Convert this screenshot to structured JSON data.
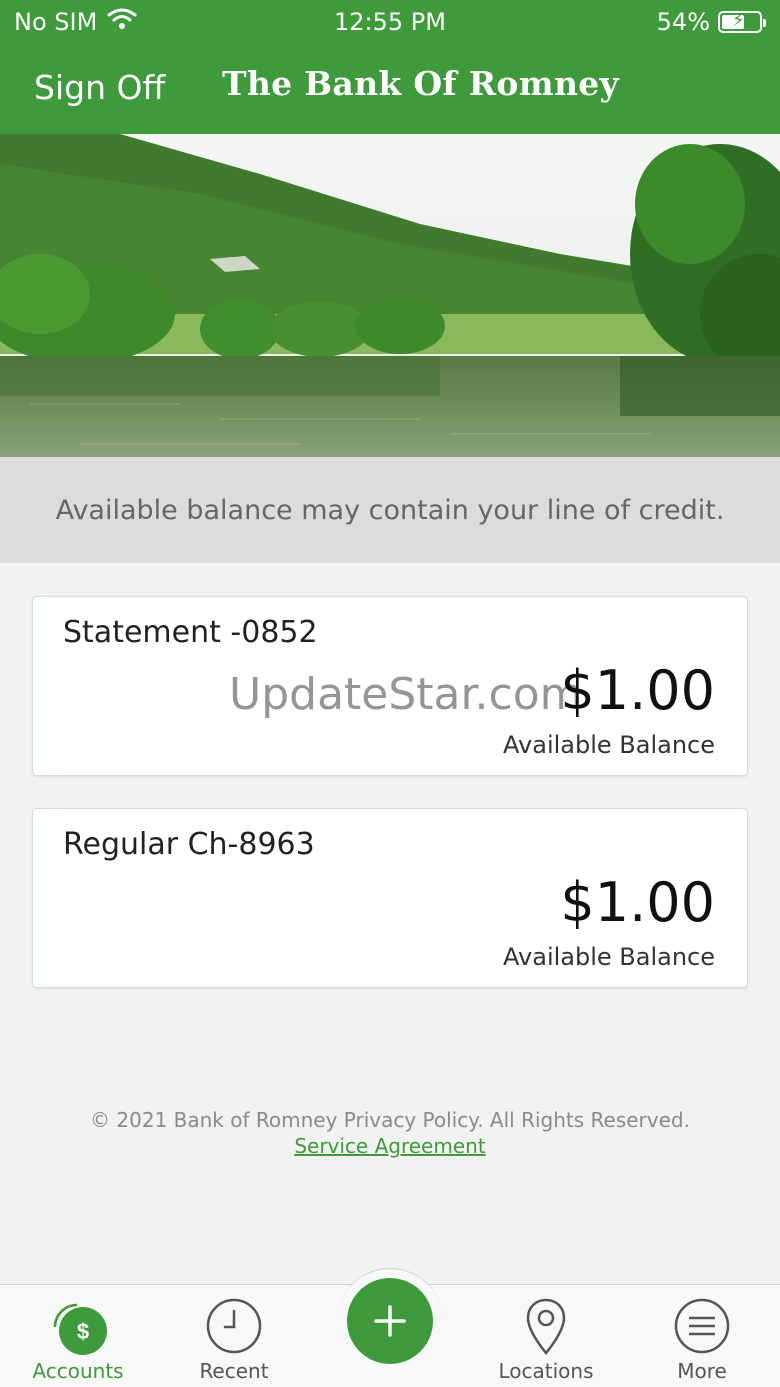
{
  "status_bar": {
    "carrier": "No SIM",
    "time": "12:55 PM",
    "battery": "54%",
    "battery_level": 0.54
  },
  "header": {
    "sign_off": "Sign Off",
    "brand": "The Bank Of Romney"
  },
  "notice": "Available balance may contain your line of credit.",
  "accounts": [
    {
      "name": "Statement -0852",
      "amount": "$1.00",
      "label": "Available Balance"
    },
    {
      "name": "Regular Ch-8963",
      "amount": "$1.00",
      "label": "Available Balance"
    }
  ],
  "watermark": "UpdateStar.com",
  "footer": {
    "copyright": "© 2021 Bank of Romney Privacy Policy. All Rights Reserved.",
    "service_agreement": "Service Agreement"
  },
  "tabs": [
    {
      "label": "Accounts",
      "icon": "dollar-icon",
      "active": true
    },
    {
      "label": "Recent",
      "icon": "clock-icon"
    },
    {
      "label": "add",
      "icon": "plus-icon"
    },
    {
      "label": "Locations",
      "icon": "location-pin-icon"
    },
    {
      "label": "More",
      "icon": "menu-icon"
    }
  ],
  "colors": {
    "brand_green": "#3e9a3a",
    "notice_bg": "#dcdcdc",
    "page_bg": "#f2f2f2"
  }
}
